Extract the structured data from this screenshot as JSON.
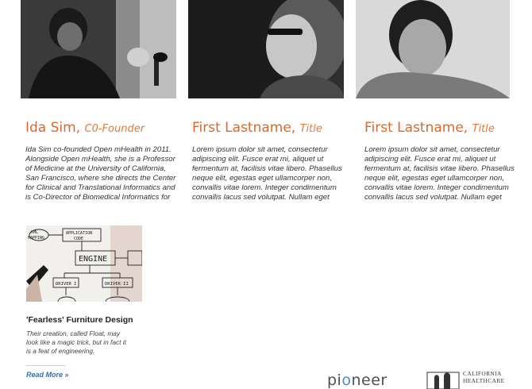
{
  "team": [
    {
      "name": "Ida Sim,",
      "role": "C0-Founder",
      "bio": "Ida Sim co-founded Open mHealth in 2011. Alongside Open mHealth, she is a Professor of Medicine at the University of California, San Francisco, where she directs the Center for Clinical and Translational Informatics and is Co-Director of Biomedical Informatics for"
    },
    {
      "name": "First Lastname,",
      "role": "Title",
      "bio": "Lorem ipsum dolor sit amet, consectetur adipiscing elit. Fusce erat mi, aliquet ut fermentum at, facilisis vitae libero. Phasellus neque elit, egestas eget ullamcorper non, convallis vitae lorem. Integer condimentum convallis lacus sed volutpat. Nullam eget"
    },
    {
      "name": "First Lastname,",
      "role": "Title",
      "bio": "Lorem ipsum dolor sit amet, consectetur adipiscing elit. Fusce erat mi, aliquet ut fermentum at, facilisis vitae libero. Phasellus neque elit, egestas eget ullamcorper non, convallis vitae lorem. Integer condimentum convallis lacus sed volutpat. Nullam eget"
    }
  ],
  "feature": {
    "title": "'Fearless' Furniture Design",
    "text": "Their creation, called Float, may look like a magic trick, but in fact it is a feat of engineering.",
    "read_more": "Read More »",
    "diagram": {
      "xml": "XML",
      "mapping": "MAPPING",
      "app_code_1": "APPLICATION",
      "app_code_2": "CODE",
      "engine": "ENGINE",
      "driver_1": "DRIVER I",
      "driver_2": "DRIVER II"
    }
  },
  "logos": {
    "pioneer_a": "pi",
    "pioneer_dot": "o",
    "pioneer_b": "neer",
    "chcf_line1": "CALIFORNIA",
    "chcf_line2": "HEALTHCARE"
  }
}
